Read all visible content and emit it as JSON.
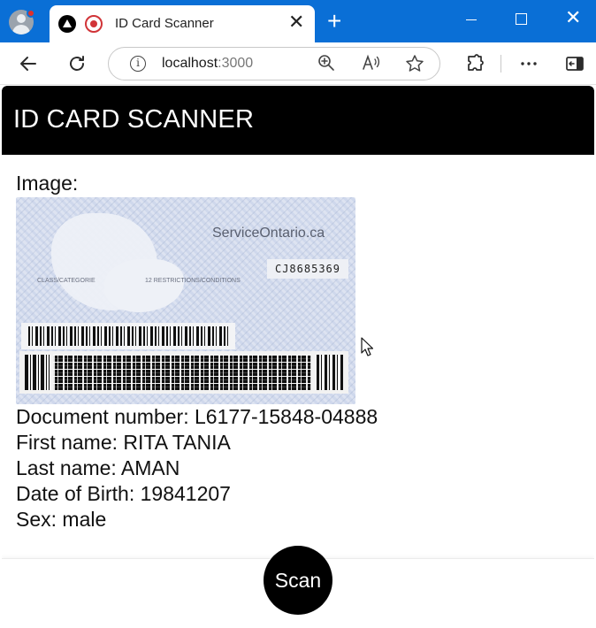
{
  "browser": {
    "tab_title": "ID Card Scanner",
    "tab_close": "✕",
    "new_tab": "+",
    "address_host": "localhost",
    "address_port": ":3000",
    "window_close": "✕"
  },
  "app": {
    "header_title": "ID CARD SCANNER",
    "image_label": "Image:",
    "card": {
      "brand": "ServiceOntario.ca",
      "number": "CJ8685369",
      "class_text": "CLASS/CATEGORIE",
      "restrictions_text": "12 RESTRICTIONS/CONDITIONS"
    },
    "fields": [
      {
        "label": "Document number: ",
        "value": "L6177-15848-04888"
      },
      {
        "label": "First name: ",
        "value": "RITA TANIA"
      },
      {
        "label": "Last name: ",
        "value": "AMAN"
      },
      {
        "label": "Date of Birth: ",
        "value": "19841207"
      },
      {
        "label": "Sex: ",
        "value": "male"
      }
    ],
    "scan_button": "Scan"
  },
  "colors": {
    "titlebar": "#0a6fd6",
    "header_bg": "#000000",
    "scan_button_bg": "#000000"
  },
  "icons": [
    "profile-avatar-icon",
    "app-logo-icon",
    "recording-icon",
    "back-arrow-icon",
    "refresh-icon",
    "info-icon",
    "zoom-icon",
    "read-aloud-icon",
    "favorite-star-icon",
    "extensions-icon",
    "more-icon",
    "sidebar-icon",
    "mouse-cursor-icon"
  ]
}
